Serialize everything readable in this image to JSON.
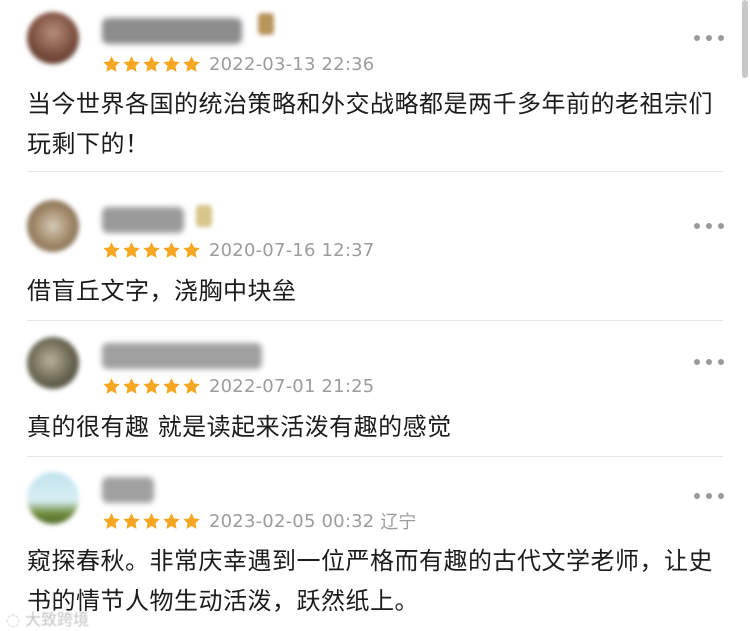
{
  "comments": [
    {
      "timestamp": "2022-03-13 22:36",
      "rating": 5,
      "location": "",
      "text": "当今世界各国的统治策略和外交战略都是两千多年前的老祖宗们玩剩下的！"
    },
    {
      "timestamp": "2020-07-16 12:37",
      "rating": 5,
      "location": "",
      "text": "借盲丘文字，浇胸中块垒"
    },
    {
      "timestamp": "2022-07-01 21:25",
      "rating": 5,
      "location": "",
      "text": "真的很有趣 就是读起来活泼有趣的感觉"
    },
    {
      "timestamp": "2023-02-05 00:32",
      "rating": 5,
      "location": "辽宁",
      "text": "窥探春秋。非常庆幸遇到一位严格而有趣的古代文学老师，让史书的情节人物生动活泼，跃然纸上。"
    }
  ],
  "colors": {
    "star": "#f5a623",
    "timestamp": "#9c9c9c",
    "divider": "#e6e6e6"
  },
  "icons": {
    "rating": "star-icon",
    "more": "more-options-icon"
  }
}
